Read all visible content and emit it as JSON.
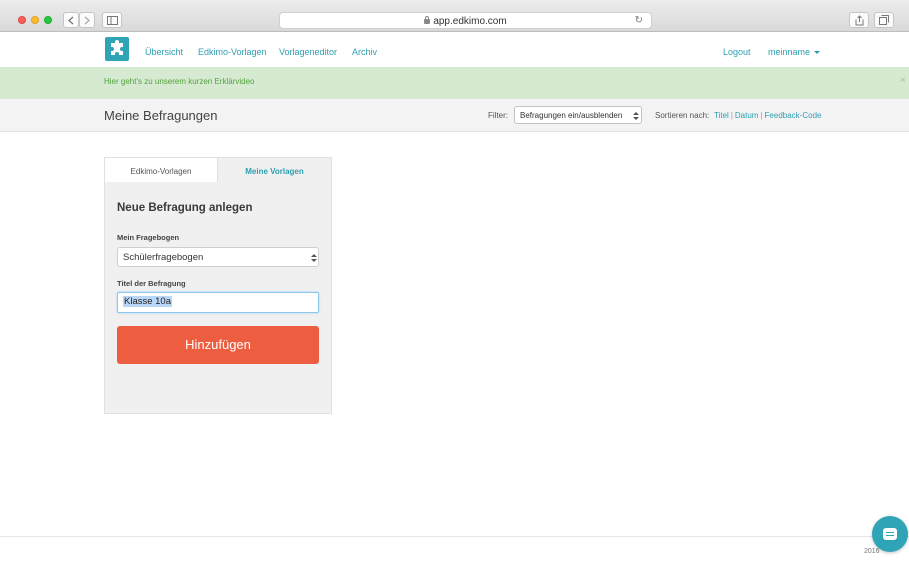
{
  "browser": {
    "url": "app.edkimo.com"
  },
  "nav": {
    "items": [
      "Übersicht",
      "Edkimo-Vorlagen",
      "Vorlageneditor",
      "Archiv"
    ],
    "logout": "Logout",
    "username": "meinname"
  },
  "banner": {
    "text": "Hier geht's zu unserem kurzen Erklärvideo",
    "close": "×"
  },
  "page": {
    "title": "Meine Befragungen",
    "filter_label": "Filter:",
    "filter_value": "Befragungen ein/ausblenden",
    "sort_label": "Sortieren nach:",
    "sort_options": [
      "Titel",
      "Datum",
      "Feedback-Code"
    ],
    "sort_separator": "|"
  },
  "card": {
    "tabs": [
      "Edkimo-Vorlagen",
      "Meine Vorlagen"
    ],
    "active_tab": "Meine Vorlagen",
    "title": "Neue Befragung anlegen",
    "questionnaire_label": "Mein Fragebogen",
    "questionnaire_value": "Schülerfragebogen",
    "survey_title_label": "Titel der Befragung",
    "survey_title_value": "Klasse 10a",
    "submit_label": "Hinzufügen"
  },
  "footer": {
    "year": "2016"
  },
  "colors": {
    "accent": "#2d9fb2",
    "brand_teal": "#2fa4b6",
    "submit_button": "#ec5e3f",
    "banner_bg": "#d5ead0",
    "banner_text": "#54a23f"
  },
  "icons": {
    "logo": "edkimo-puzzle-logo-icon",
    "chat": "chat-bubble-icon"
  }
}
